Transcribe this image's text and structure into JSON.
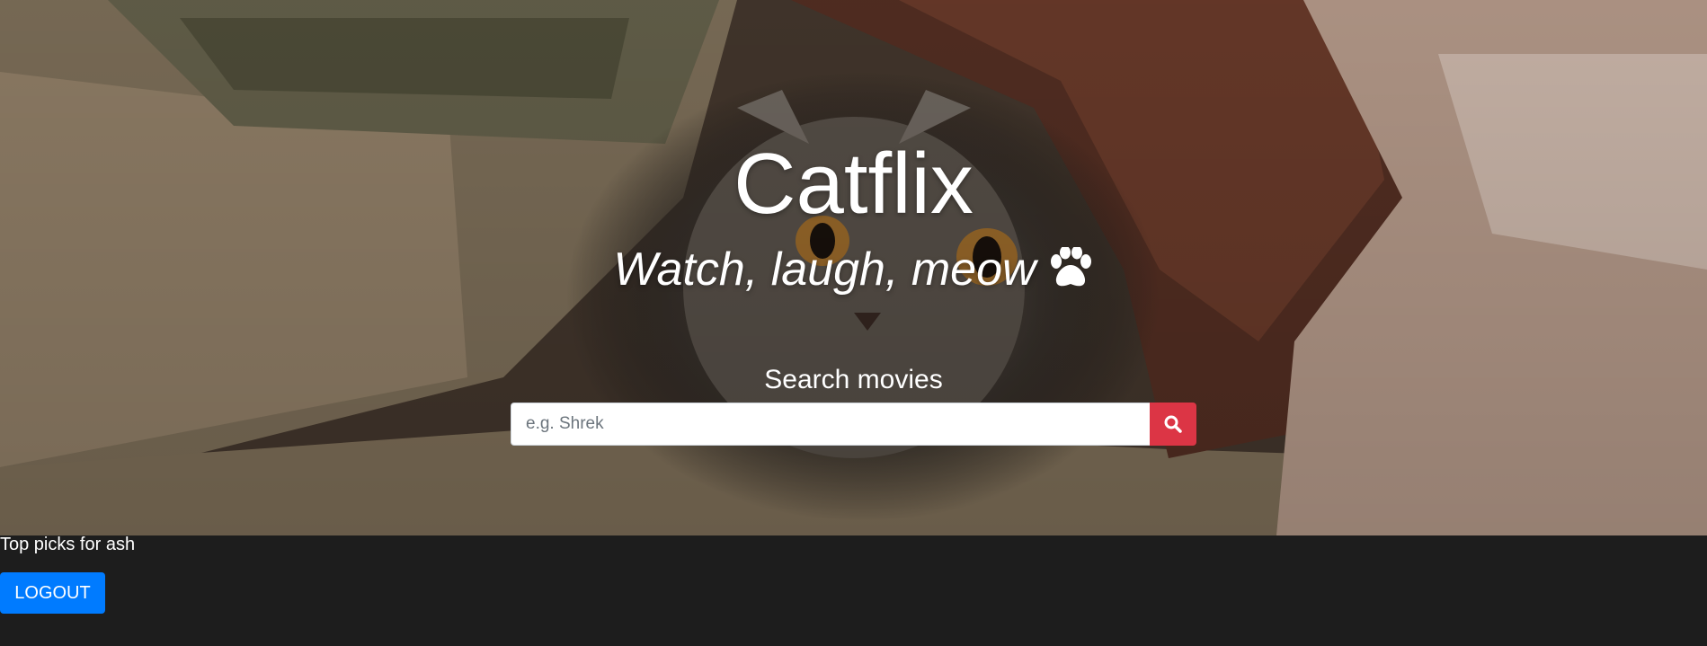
{
  "hero": {
    "title": "Catflix",
    "tagline": "Watch, laugh, meow",
    "paw_icon": "paw-icon",
    "background": "cat-under-blanket-photo"
  },
  "search": {
    "label": "Search movies",
    "placeholder": "e.g. Shrek",
    "value": "",
    "button_icon": "search-icon"
  },
  "user_section": {
    "top_picks_label": "Top picks for ash",
    "logout_label": "LOGOUT"
  },
  "colors": {
    "page_background": "#1d1d1d",
    "search_button": "#dc3545",
    "logout_button": "#007bff",
    "text": "#ffffff"
  }
}
